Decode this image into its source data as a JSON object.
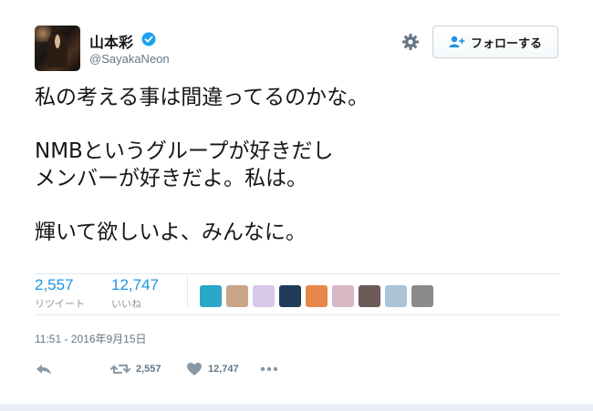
{
  "user": {
    "name": "山本彩",
    "handle": "@SayakaNeon",
    "verified": true
  },
  "follow_button": {
    "label": "フォローする"
  },
  "tweet": {
    "lines": [
      "私の考える事は間違ってるのかな。",
      "NMBというグループが好きだし",
      "メンバーが好きだよ。私は。",
      "輝いて欲しいよ、みんなに。"
    ],
    "timestamp": "11:51 - 2016年9月15日"
  },
  "stats": {
    "retweets": {
      "count": "2,557",
      "label": "リツイート"
    },
    "likes": {
      "count": "12,747",
      "label": "いいね"
    }
  },
  "likers": [
    {
      "color": "#2aa6c8"
    },
    {
      "color": "#c9a58a"
    },
    {
      "color": "#d8c8e8"
    },
    {
      "color": "#223a5a"
    },
    {
      "color": "#e8874a"
    },
    {
      "color": "#d9b6c4"
    },
    {
      "color": "#6b5a55"
    },
    {
      "color": "#a9c4d6"
    },
    {
      "color": "#8a8a8a"
    }
  ],
  "actions": {
    "retweet_count": "2,557",
    "like_count": "12,747"
  },
  "colors": {
    "accent": "#1b95e0",
    "verified": "#1da1f2",
    "muted": "#657786"
  }
}
